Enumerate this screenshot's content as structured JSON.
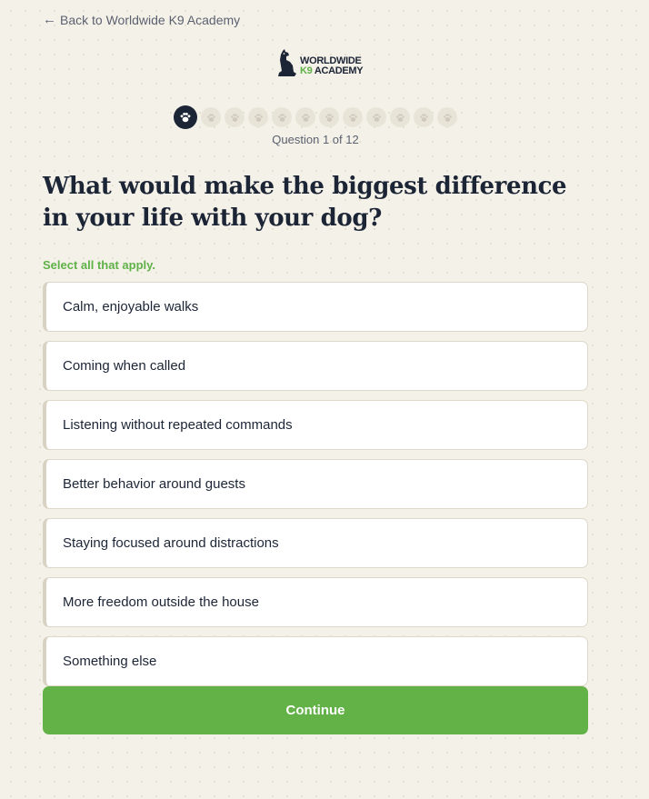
{
  "nav": {
    "back_label": "Back to Worldwide K9 Academy"
  },
  "logo": {
    "line1": "WORLDWIDE",
    "line2_k9": "K9",
    "line2_rest": " ACADEMY"
  },
  "progress": {
    "current": 1,
    "total": 12,
    "label": "Question 1 of 12"
  },
  "question": {
    "title": "What would make the biggest difference in your life with your dog?",
    "hint": "Select all that apply."
  },
  "options": [
    "Calm, enjoyable walks",
    "Coming when called",
    "Listening without repeated commands",
    "Better behavior around guests",
    "Staying focused around distractions",
    "More freedom outside the house",
    "Something else"
  ],
  "actions": {
    "continue_label": "Continue"
  },
  "colors": {
    "accent": "#62b247",
    "navy": "#1c2536",
    "background": "#f4f1e8"
  }
}
